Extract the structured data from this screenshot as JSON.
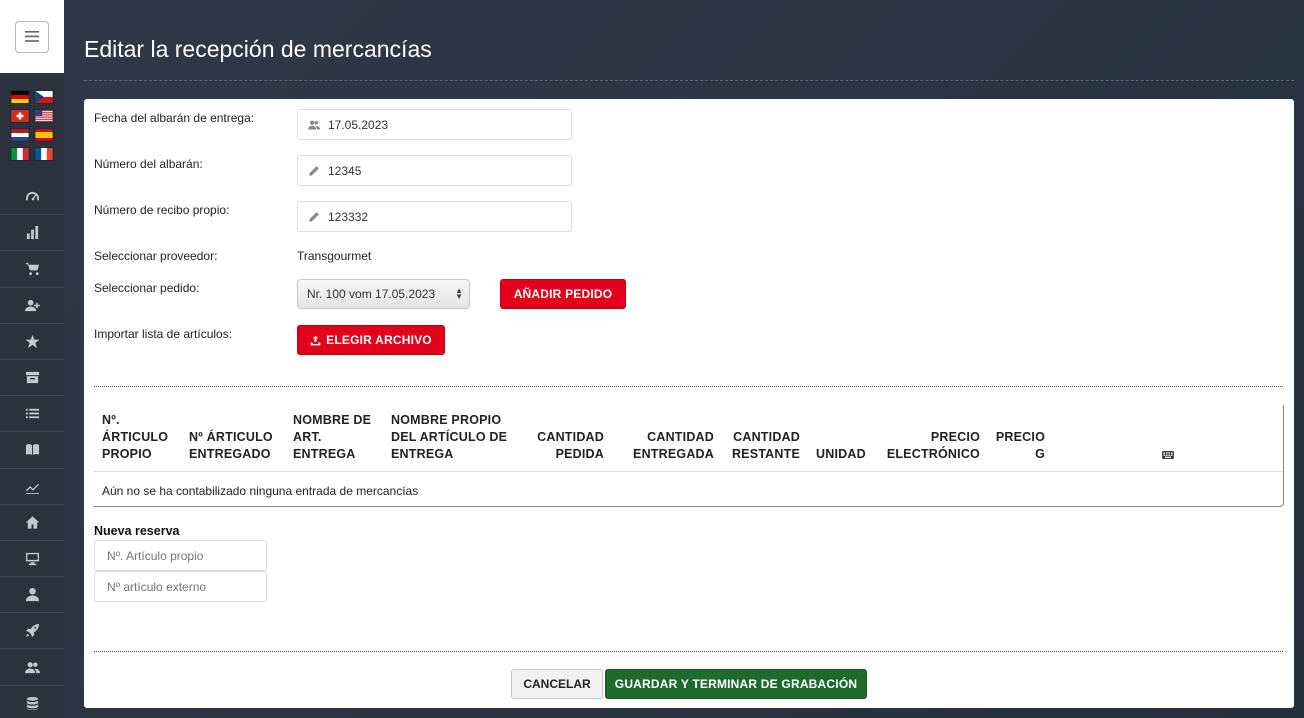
{
  "page": {
    "title": "Editar la recepción de mercancías"
  },
  "sidebar": {
    "flags": [
      "de-flag-icon",
      "cz-flag-icon",
      "ch-flag-icon",
      "us-flag-icon",
      "nl-flag-icon",
      "es-flag-icon",
      "it-flag-icon",
      "fr-flag-icon"
    ],
    "nav_icons": [
      "dashboard-icon",
      "chart-icon",
      "cart-icon",
      "add-user-icon",
      "star-icon",
      "archive-icon",
      "list-icon",
      "book-icon",
      "trend-icon",
      "home-icon",
      "monitor-icon",
      "user-icon",
      "rocket-icon",
      "users-icon",
      "database-icon"
    ]
  },
  "form": {
    "delivery_date": {
      "label": "Fecha del albarán de entrega:",
      "value": "17.05.2023"
    },
    "delivery_number": {
      "label": "Número del albarán:",
      "value": "12345"
    },
    "own_receipt_number": {
      "label": "Número de recibo propio:",
      "value": "123332"
    },
    "supplier": {
      "label": "Seleccionar proveedor:",
      "value": "Transgourmet"
    },
    "order": {
      "label": "Seleccionar pedido:",
      "selected": "Nr. 100 vom 17.05.2023",
      "add_button": "AÑADIR PEDIDO"
    },
    "import": {
      "label": "Importar lista de artículos:",
      "button": "ELEGIR ARCHIVO"
    }
  },
  "table": {
    "headers": [
      [
        "Nº.",
        "ÁRTICULO",
        "PROPIO"
      ],
      [
        "Nº ÁRTICULO",
        "ENTREGADO"
      ],
      [
        "NOMBRE DE",
        "ART.",
        "ENTREGA"
      ],
      [
        "NOMBRE PROPIO",
        "DEL ARTÍCULO DE",
        "ENTREGA"
      ],
      [
        "CANTIDAD",
        "PEDIDA"
      ],
      [
        "CANTIDAD",
        "ENTREGADA"
      ],
      [
        "CANTIDAD",
        "RESTANTE"
      ],
      [
        "UNIDAD"
      ],
      [
        "PRECIO",
        "ELECTRÓNICO"
      ],
      [
        "PRECIO",
        "G"
      ]
    ],
    "empty_message": "Aún no se ha contabilizado ninguna entrada de mercancías"
  },
  "new_reservation": {
    "title": "Nueva reserva",
    "own_article_placeholder": "Nº. Artículo propio",
    "external_article_placeholder": "Nº artículo externo"
  },
  "footer": {
    "cancel_label": "CANCELAR",
    "save_label": "GUARDAR Y TERMINAR DE GRABACIÓN"
  }
}
